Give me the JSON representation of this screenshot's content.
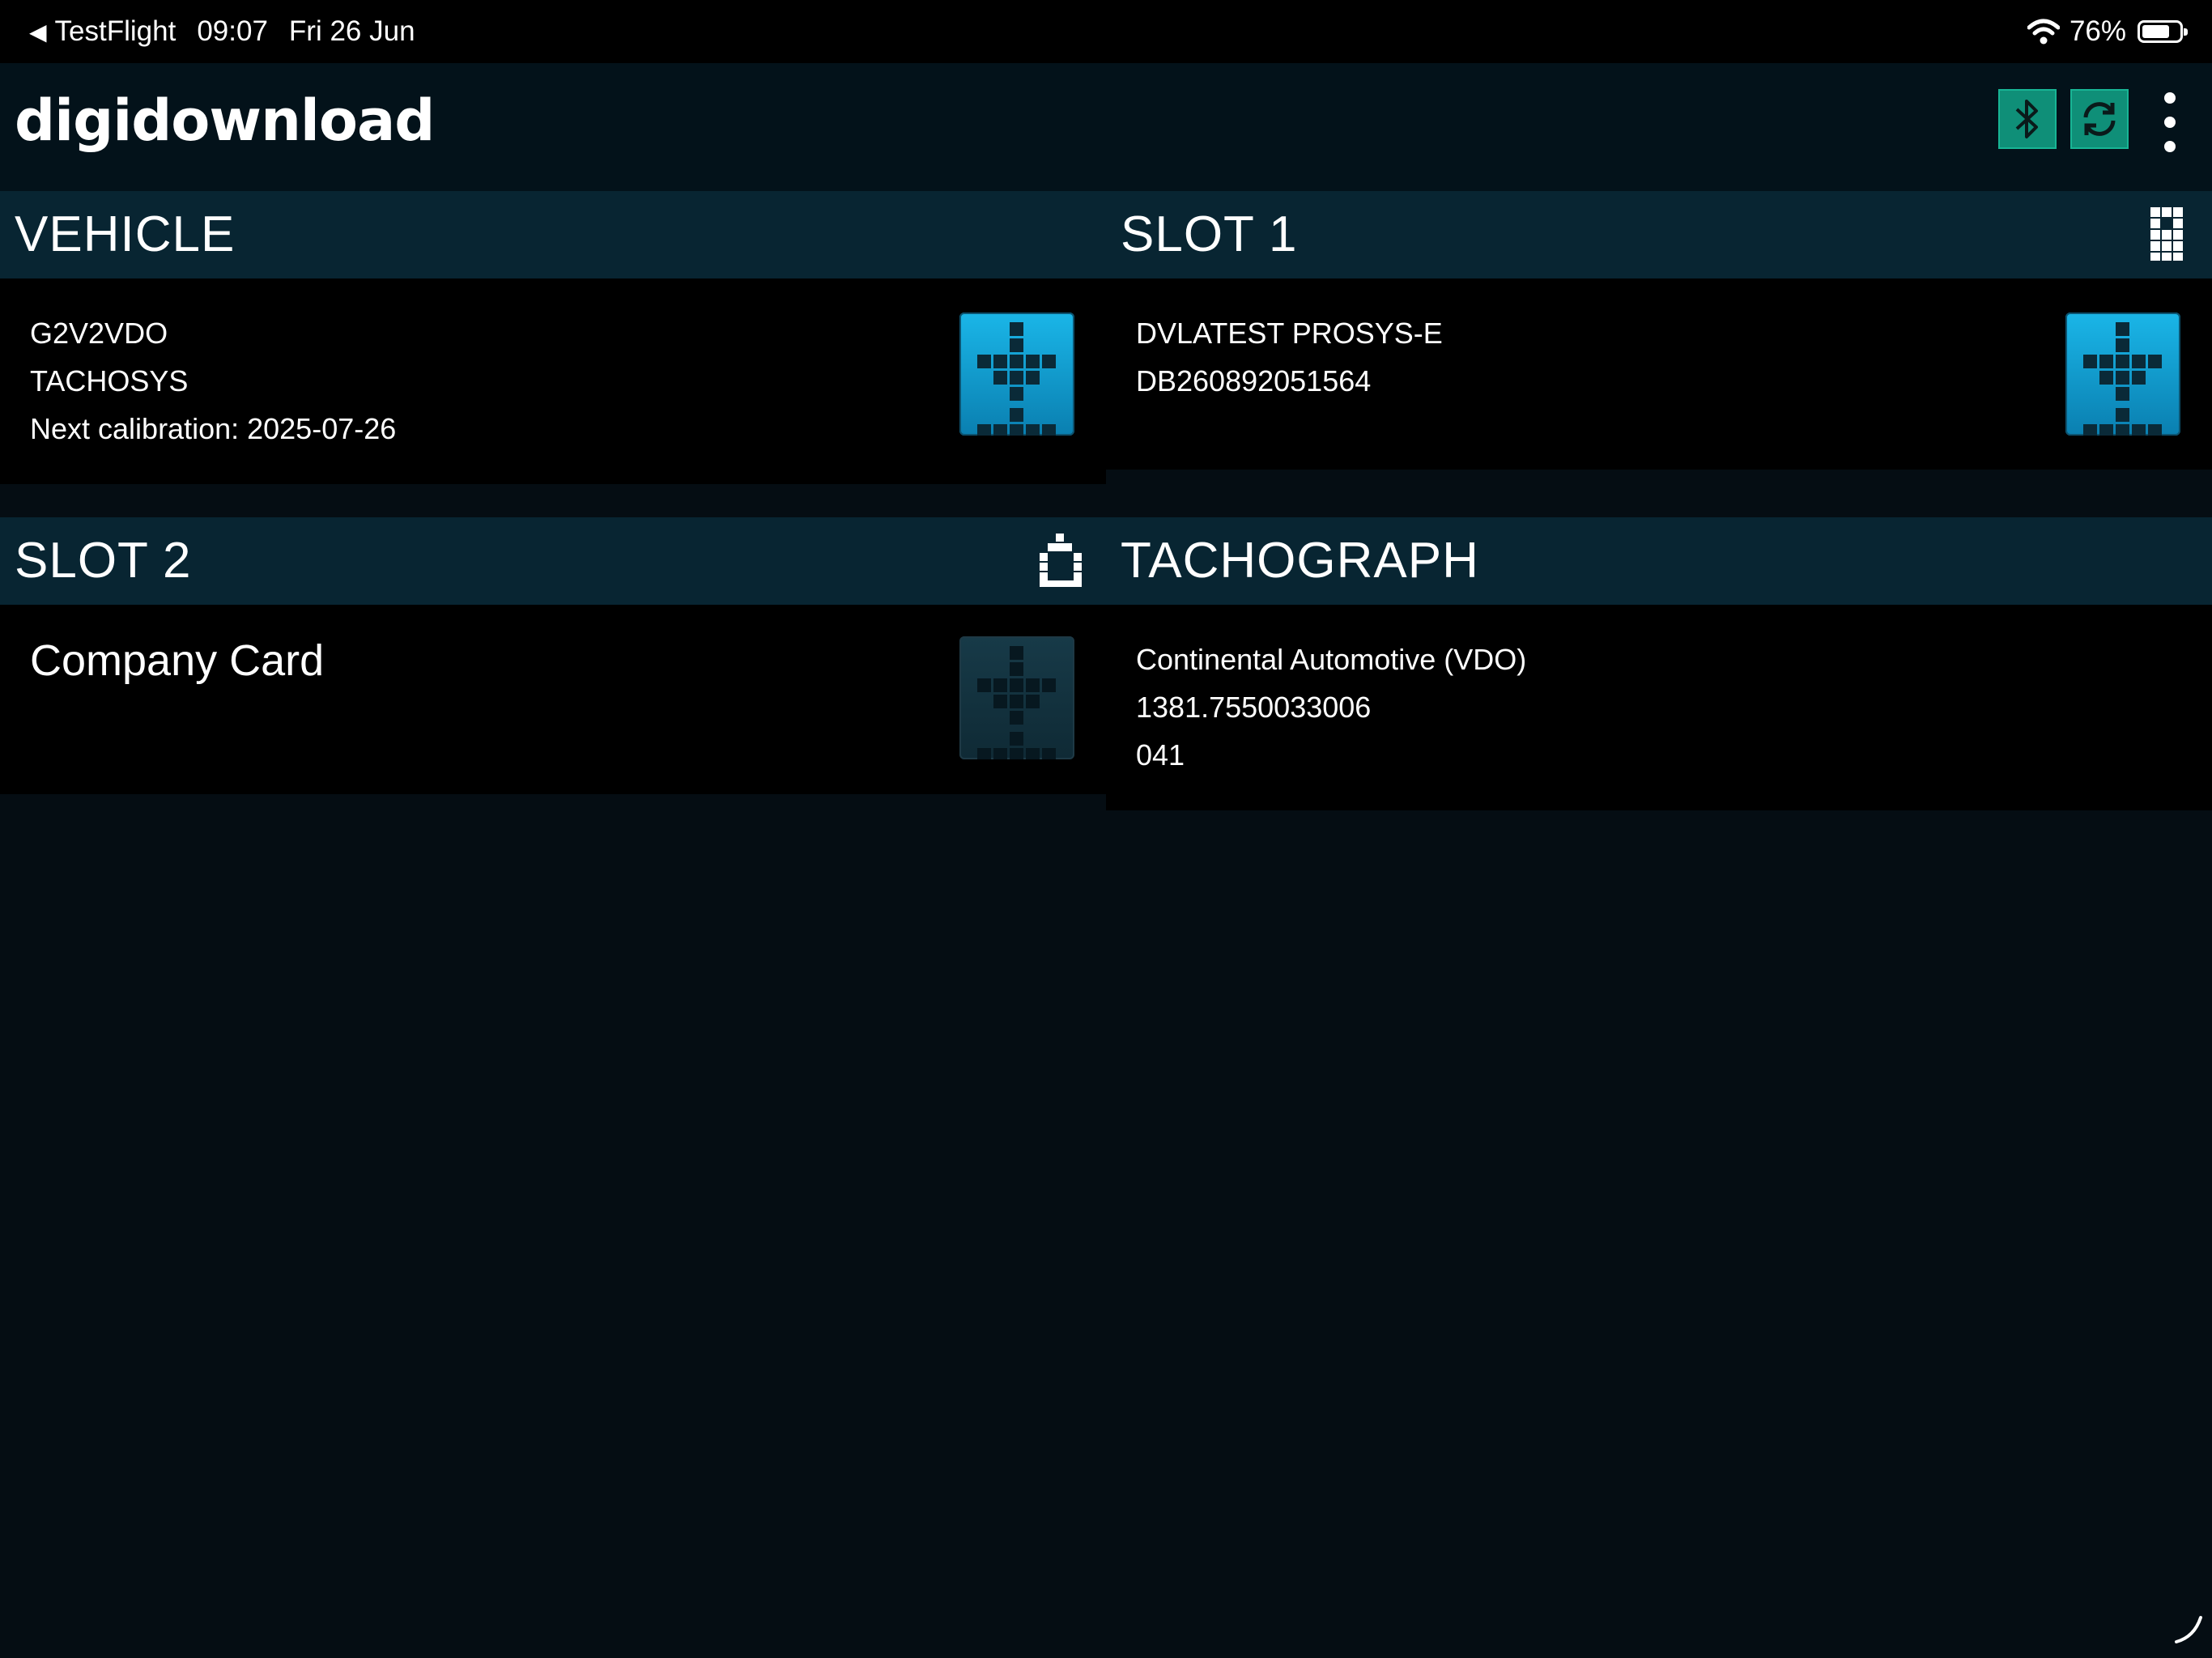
{
  "status_bar": {
    "back_app": "TestFlight",
    "time": "09:07",
    "date": "Fri 26 Jun",
    "battery": "76%",
    "battery_level": 0.76
  },
  "header": {
    "logo": "digidownload",
    "icons": [
      "bluetooth-icon",
      "sync-icon",
      "more-vertical-icon"
    ]
  },
  "vehicle": {
    "title": "VEHICLE",
    "lines": [
      "G2V2VDO",
      "TACHOSYS",
      "Next calibration: 2025-07-26"
    ]
  },
  "slot1": {
    "title": "SLOT 1",
    "lines": [
      "DVLATEST PROSYS-E",
      "DB260892051564"
    ]
  },
  "slot2": {
    "title": "SLOT 2",
    "card_label": "Company Card"
  },
  "tachograph": {
    "title": "TACHOGRAPH",
    "lines": [
      "Continental Automotive (VDO)",
      "1381.7550033006",
      "041"
    ]
  },
  "colors": {
    "background": "#050d13",
    "panel_header": "#082532",
    "panel_body": "#000000",
    "accent_green": "#0f8f78",
    "download_blue": "#1ab6e8"
  }
}
